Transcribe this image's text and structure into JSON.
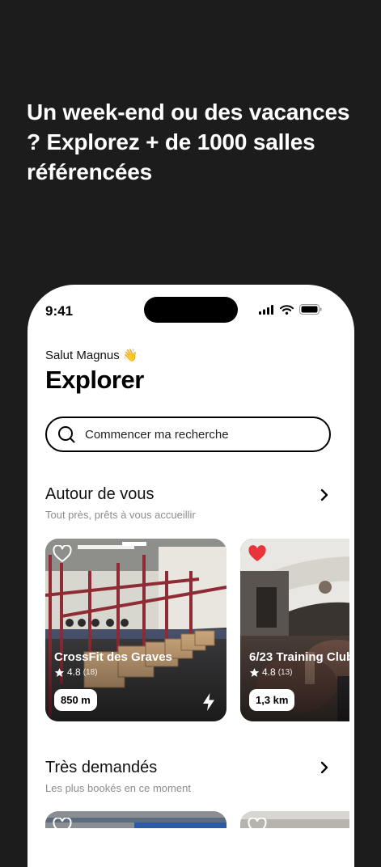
{
  "headline": "Un week-end ou des vacances ? Explorez + de 1000 salles référencées",
  "status_bar": {
    "time": "9:41"
  },
  "greeting": "Salut Magnus 👋",
  "page_title": "Explorer",
  "search": {
    "placeholder": "Commencer ma recherche"
  },
  "sections": [
    {
      "title": "Autour de vous",
      "subtitle": "Tout près, prêts à vous accueillir"
    },
    {
      "title": "Très demandés",
      "subtitle": "Les plus bookés en ce moment"
    }
  ],
  "gyms": [
    {
      "name": "CrossFit des Graves",
      "rating": "4.8",
      "reviews": "(18)",
      "distance": "850 m",
      "favorite": false,
      "instant_booking": true
    },
    {
      "name": "6/23 Training Club",
      "rating": "4.8",
      "reviews": "(13)",
      "distance": "1,3 km",
      "favorite": true,
      "instant_booking": false
    }
  ],
  "colors": {
    "background": "#1c1c1c",
    "favorite": "#e8343a"
  }
}
